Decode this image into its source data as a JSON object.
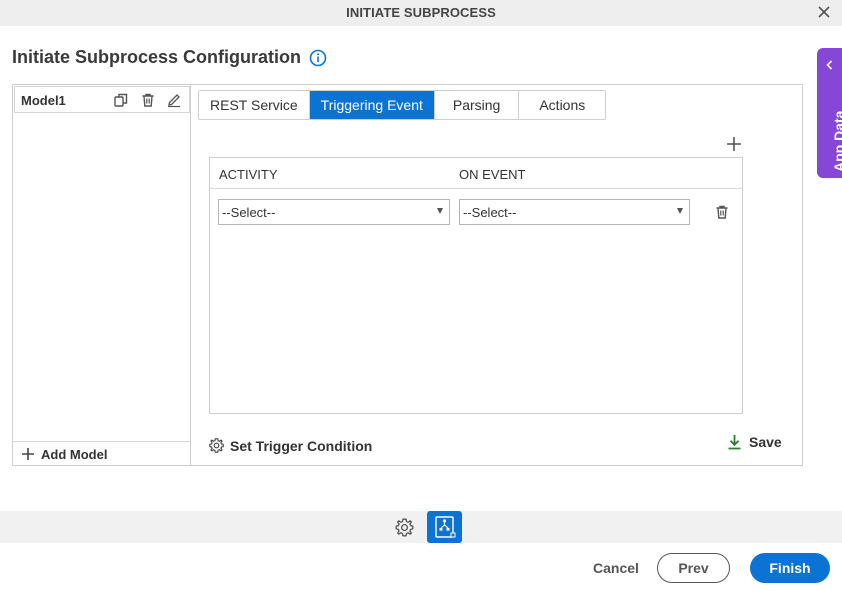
{
  "window": {
    "title": "INITIATE SUBPROCESS",
    "close_icon": "close-icon"
  },
  "page": {
    "heading": "Initiate Subprocess Configuration",
    "info_icon": "info-icon"
  },
  "side_panel": {
    "label": "App Data",
    "color": "#8646d8"
  },
  "models": {
    "items": [
      {
        "name": "Model1",
        "icons": [
          "copy-icon",
          "delete-icon",
          "edit-icon"
        ]
      }
    ],
    "add_label": "Add Model"
  },
  "tabs": [
    {
      "label": "REST Service",
      "active": false
    },
    {
      "label": "Triggering Event",
      "active": true
    },
    {
      "label": "Parsing",
      "active": false
    },
    {
      "label": "Actions",
      "active": false
    }
  ],
  "grid": {
    "columns": [
      "ACTIVITY",
      "ON EVENT"
    ],
    "rows": [
      {
        "activity": "--Select--",
        "on_event": "--Select--"
      }
    ]
  },
  "actions": {
    "set_trigger": "Set Trigger Condition",
    "save": "Save"
  },
  "footer": {
    "cancel": "Cancel",
    "prev": "Prev",
    "finish": "Finish"
  },
  "colors": {
    "accent": "#0a73d4",
    "save_icon": "#2e7d32"
  }
}
